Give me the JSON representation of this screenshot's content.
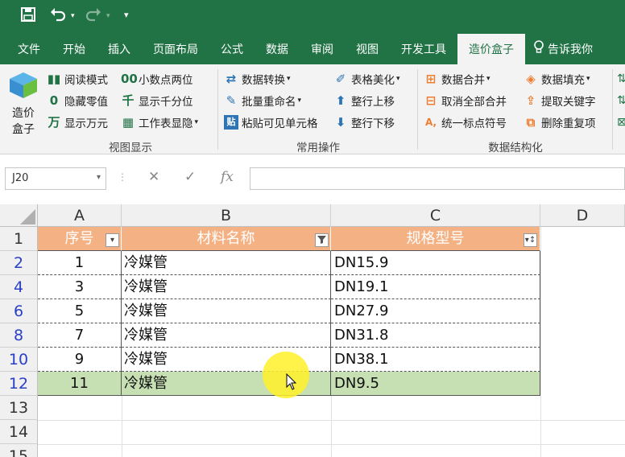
{
  "titlebar": {
    "save_icon": "save-icon",
    "undo_icon": "undo-icon",
    "redo_icon": "redo-icon",
    "customize": "▾"
  },
  "tabs": [
    {
      "label": "文件"
    },
    {
      "label": "开始"
    },
    {
      "label": "插入"
    },
    {
      "label": "页面布局"
    },
    {
      "label": "公式"
    },
    {
      "label": "数据"
    },
    {
      "label": "审阅"
    },
    {
      "label": "视图"
    },
    {
      "label": "开发工具"
    },
    {
      "label": "造价盒子"
    }
  ],
  "tellme": "告诉我你",
  "ribbon": {
    "big_button": {
      "line1": "造价",
      "line2": "盒子"
    },
    "group1": {
      "label": "视图显示",
      "items": [
        "阅读模式",
        "隐藏零值",
        "显示万元",
        "小数点两位",
        "显示千分位",
        "工作表显隐"
      ]
    },
    "group2": {
      "label": "常用操作",
      "items": [
        "数据转换",
        "批量重命名",
        "粘贴可见单元格",
        "表格美化",
        "整行上移",
        "整行下移"
      ]
    },
    "group3": {
      "label": "数据结构化",
      "items": [
        "数据合并",
        "取消全部合并",
        "统一标点符号",
        "数据填充",
        "提取关键字",
        "删除重复项"
      ]
    }
  },
  "formula_bar": {
    "name_box": "J20",
    "cancel": "✕",
    "confirm": "✓",
    "fx": "fx",
    "value": ""
  },
  "columns": [
    "A",
    "B",
    "C",
    "D"
  ],
  "header_row": {
    "row": "1",
    "cells": [
      "序号",
      "材料名称",
      "规格型号"
    ]
  },
  "rows": [
    {
      "row": "2",
      "cells": [
        "1",
        "冷媒管",
        "DN15.9"
      ]
    },
    {
      "row": "4",
      "cells": [
        "3",
        "冷媒管",
        "DN19.1"
      ]
    },
    {
      "row": "6",
      "cells": [
        "5",
        "冷媒管",
        "DN27.9"
      ]
    },
    {
      "row": "8",
      "cells": [
        "7",
        "冷媒管",
        "DN31.8"
      ]
    },
    {
      "row": "10",
      "cells": [
        "9",
        "冷媒管",
        "DN38.1"
      ]
    },
    {
      "row": "12",
      "cells": [
        "11",
        "冷媒管",
        "DN9.5"
      ]
    }
  ],
  "empty_rows": [
    "13",
    "14",
    "15"
  ],
  "colors": {
    "ribbon_green": "#217346",
    "header_fill": "#f4b183",
    "selected_row": "#c6e0b4",
    "filtered_row_number": "#2a3fc7"
  }
}
